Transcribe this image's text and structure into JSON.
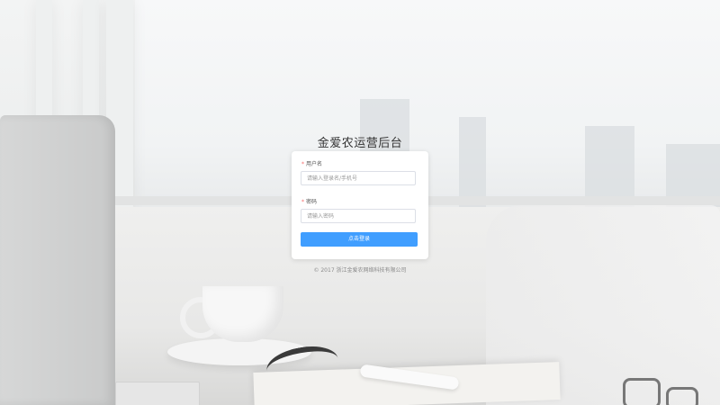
{
  "app_title": "金爱农运营后台",
  "form": {
    "username_label": "用户名",
    "username_placeholder": "请输入登录名/手机号",
    "password_label": "密码",
    "password_placeholder": "请输入密码",
    "required_marker": "*",
    "login_button": "点击登录"
  },
  "footer": {
    "copyright": "© 2017 浙江金爱农网络科技有限公司"
  },
  "colors": {
    "primary_button": "#409eff",
    "required_marker": "#f56c6c"
  }
}
